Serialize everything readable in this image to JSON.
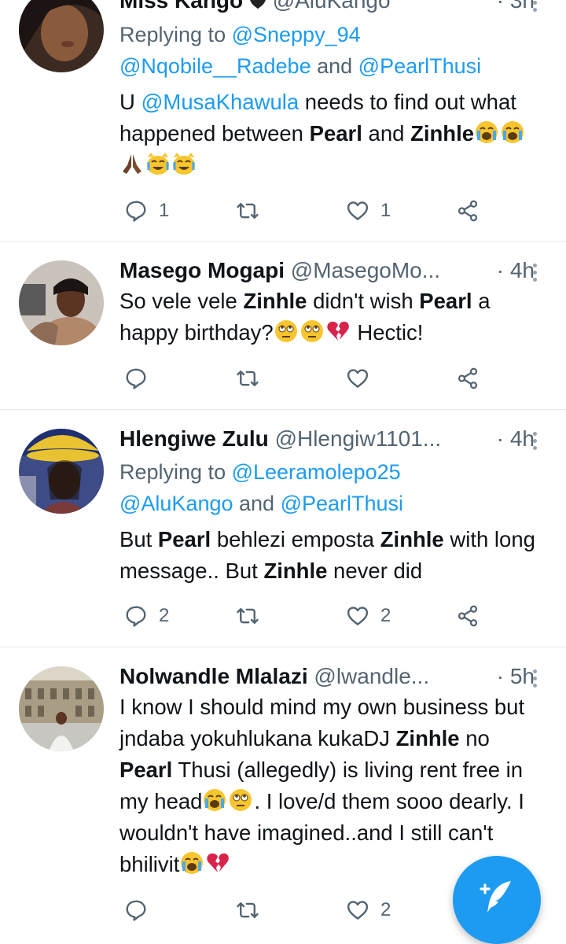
{
  "tweets": [
    {
      "name": "Miss Kango",
      "handle": "@AluKango",
      "time": "· 3h",
      "replying_prefix": "Replying to ",
      "replying_to_1": "@Sneppy_94",
      "replying_to_2": "@Nqobile__Radebe",
      "replying_and": " and ",
      "replying_to_3": "@PearlThusi",
      "text": {
        "a": "U ",
        "mention": "@MusaKhawula",
        "b": " needs to find out what happened between ",
        "bold1": "Pearl",
        "c": " and ",
        "bold2": "Zinhle"
      },
      "emojis": [
        "loudly-crying-face",
        "loudly-crying-face",
        "folded-hands",
        "cat-tears-of-joy",
        "cat-tears-of-joy"
      ],
      "replies": "1",
      "retweets": "",
      "likes": "1"
    },
    {
      "name": "Masego Mogapi",
      "handle": "@MasegoMo...",
      "time": "· 4h",
      "text": {
        "a": "So vele vele ",
        "bold1": "Zinhle",
        "b": " didn't wish ",
        "bold2": "Pearl",
        "c": " a happy birthday?",
        "d": " Hectic!"
      },
      "emojis": [
        "eye-roll-face",
        "eye-roll-face",
        "broken-heart"
      ],
      "replies": "",
      "retweets": "",
      "likes": ""
    },
    {
      "name": "Hlengiwe Zulu",
      "handle": "@Hlengiw1101...",
      "time": "· 4h",
      "replying_prefix": "Replying to ",
      "replying_to_1": "@Leeramolepo25",
      "replying_to_2": "@AluKango",
      "replying_and": " and ",
      "replying_to_3": "@PearlThusi",
      "text": {
        "a": "But ",
        "bold1": "Pearl",
        "b": " behlezi emposta ",
        "bold2": "Zinhle",
        "c": " with long message.. But ",
        "bold3": "Zinhle",
        "d": " never did"
      },
      "replies": "2",
      "retweets": "",
      "likes": "2"
    },
    {
      "name": "Nolwandle Mlalazi",
      "handle": "@lwandle...",
      "time": "· 5h",
      "text": {
        "a": "I know I should mind my own business but jndaba yokuhlukana kukaDJ ",
        "bold1": "Zinhle",
        "b": " no ",
        "bold2": "Pearl",
        "c": " Thusi (allegedly) is living rent free in my head",
        "d": ". I love/d them sooo dearly. I wouldn't have imagined..and I still can't bhilivit"
      },
      "emojis": [
        "loudly-crying-face",
        "eye-roll-face",
        "loudly-crying-face",
        "broken-heart"
      ],
      "replies": "",
      "retweets": "",
      "likes": "2"
    }
  ],
  "icons": {
    "reply": "reply-bubble-icon",
    "retweet": "retweet-icon",
    "like": "heart-icon",
    "share": "share-icon",
    "more": "more-vertical-icon",
    "compose": "compose-feather-icon"
  },
  "colors": {
    "accent": "#1d9bf0",
    "text": "#0f1419",
    "muted": "#536471",
    "divider": "#e6e9ec"
  }
}
